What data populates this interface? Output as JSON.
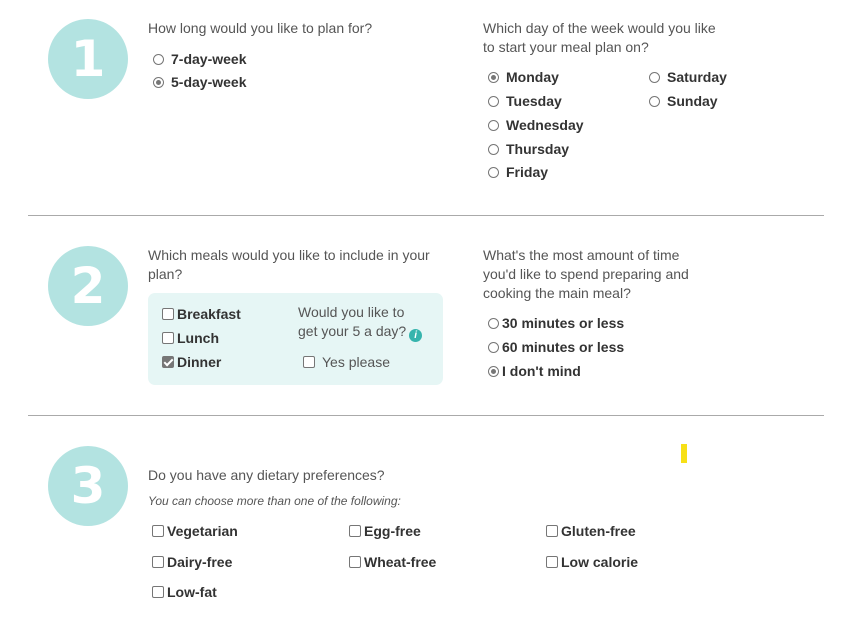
{
  "steps": [
    "1",
    "2",
    "3"
  ],
  "section1": {
    "plan_length_question": "How long would you like to plan for?",
    "plan_length_options": [
      {
        "label": "7-day-week",
        "checked": false
      },
      {
        "label": "5-day-week",
        "checked": true
      }
    ],
    "start_day_question_line1": "Which day of the week would you like",
    "start_day_question_line2": "to start your meal plan on?",
    "days": [
      {
        "label": "Monday",
        "checked": true
      },
      {
        "label": "Tuesday",
        "checked": false
      },
      {
        "label": "Wednesday",
        "checked": false
      },
      {
        "label": "Thursday",
        "checked": false
      },
      {
        "label": "Friday",
        "checked": false
      },
      {
        "label": "Saturday",
        "checked": false
      },
      {
        "label": "Sunday",
        "checked": false
      }
    ]
  },
  "section2": {
    "meals_question_line1": "Which meals would you like to include in your",
    "meals_question_line2": "plan?",
    "meals": [
      {
        "label": "Breakfast",
        "checked": false
      },
      {
        "label": "Lunch",
        "checked": false
      },
      {
        "label": "Dinner",
        "checked": true
      }
    ],
    "five_a_day_line1": "Would you like to",
    "five_a_day_line2": "get your 5 a day?",
    "info_icon_glyph": "i",
    "five_a_day_option": {
      "label": "Yes please",
      "checked": false
    },
    "time_question_line1": "What's the most amount of time",
    "time_question_line2": "you'd like to spend preparing and",
    "time_question_line3": "cooking the main meal?",
    "time_options": [
      {
        "label": "30 minutes or less",
        "checked": false
      },
      {
        "label": "60 minutes or less",
        "checked": false
      },
      {
        "label": "I don't mind",
        "checked": true
      }
    ]
  },
  "section3": {
    "dietary_question": "Do you have any dietary preferences?",
    "dietary_hint": "You can choose more than one of the following:",
    "preferences": [
      {
        "label": "Vegetarian",
        "checked": false
      },
      {
        "label": "Egg-free",
        "checked": false
      },
      {
        "label": "Gluten-free",
        "checked": false
      },
      {
        "label": "Dairy-free",
        "checked": false
      },
      {
        "label": "Wheat-free",
        "checked": false
      },
      {
        "label": "Low calorie",
        "checked": false
      },
      {
        "label": "Low-fat",
        "checked": false
      }
    ]
  },
  "colors": {
    "step_circle": "#b3e3e1",
    "meals_box": "#e6f6f5",
    "info_icon": "#36b4ad",
    "highlight_mark": "#f7e017"
  }
}
